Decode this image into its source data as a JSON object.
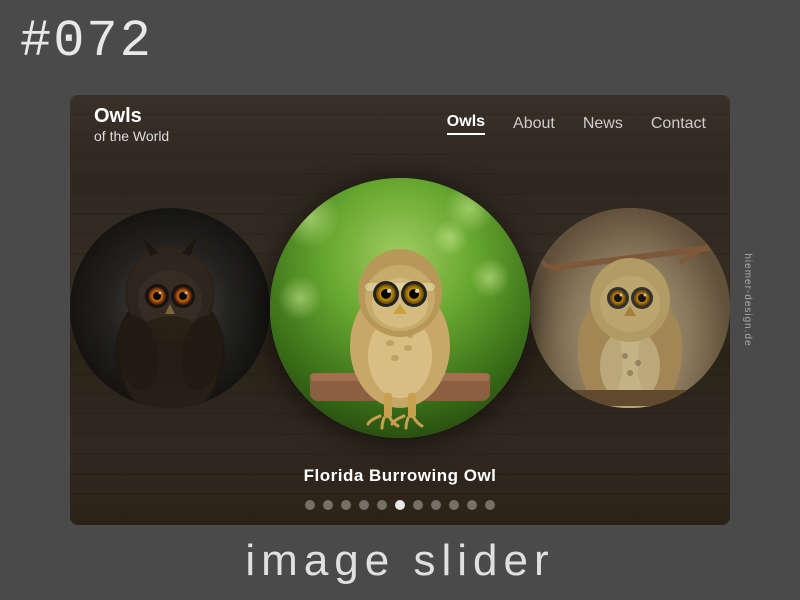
{
  "top_label": "#072",
  "bottom_label": "image slider",
  "side_text": "hiemer-design.de",
  "navbar": {
    "brand_title": "Owls",
    "brand_subtitle": "of the World",
    "nav_items": [
      {
        "label": "Owls",
        "active": true
      },
      {
        "label": "About",
        "active": false
      },
      {
        "label": "News",
        "active": false
      },
      {
        "label": "Contact",
        "active": false
      }
    ]
  },
  "slider": {
    "caption": "Florida Burrowing Owl",
    "dots_count": 11,
    "active_dot": 5
  }
}
